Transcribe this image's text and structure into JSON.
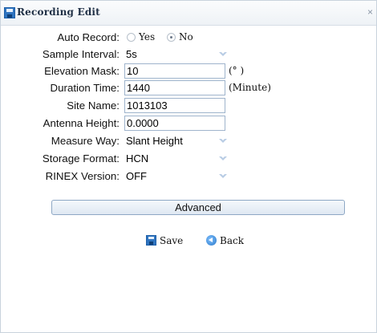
{
  "window": {
    "title": "Recording Edit",
    "close_glyph": "×"
  },
  "form": {
    "auto_record": {
      "label": "Auto Record:",
      "options": [
        "Yes",
        "No"
      ],
      "selected": "No"
    },
    "sample_interval": {
      "label": "Sample Interval:",
      "value": "5s"
    },
    "elevation_mask": {
      "label": "Elevation Mask:",
      "value": "10",
      "unit": "(° )"
    },
    "duration_time": {
      "label": "Duration Time:",
      "value": "1440",
      "unit": "(Minute)"
    },
    "site_name": {
      "label": "Site Name:",
      "value": "1013103"
    },
    "antenna_height": {
      "label": "Antenna Height:",
      "value": "0.0000"
    },
    "measure_way": {
      "label": "Measure Way:",
      "value": "Slant Height"
    },
    "storage_format": {
      "label": "Storage Format:",
      "value": "HCN"
    },
    "rinex_version": {
      "label": "RINEX Version:",
      "value": "OFF"
    }
  },
  "buttons": {
    "advanced": "Advanced",
    "save": "Save",
    "back": "Back"
  },
  "icons": {
    "title": "save-disk-icon",
    "save": "save-disk-icon",
    "back": "back-arrow-icon",
    "dropdown": "chevron-down-icon"
  },
  "colors": {
    "accent": "#2f74c0",
    "input_border": "#9fb4cc",
    "button_border": "#8ea8c5"
  }
}
